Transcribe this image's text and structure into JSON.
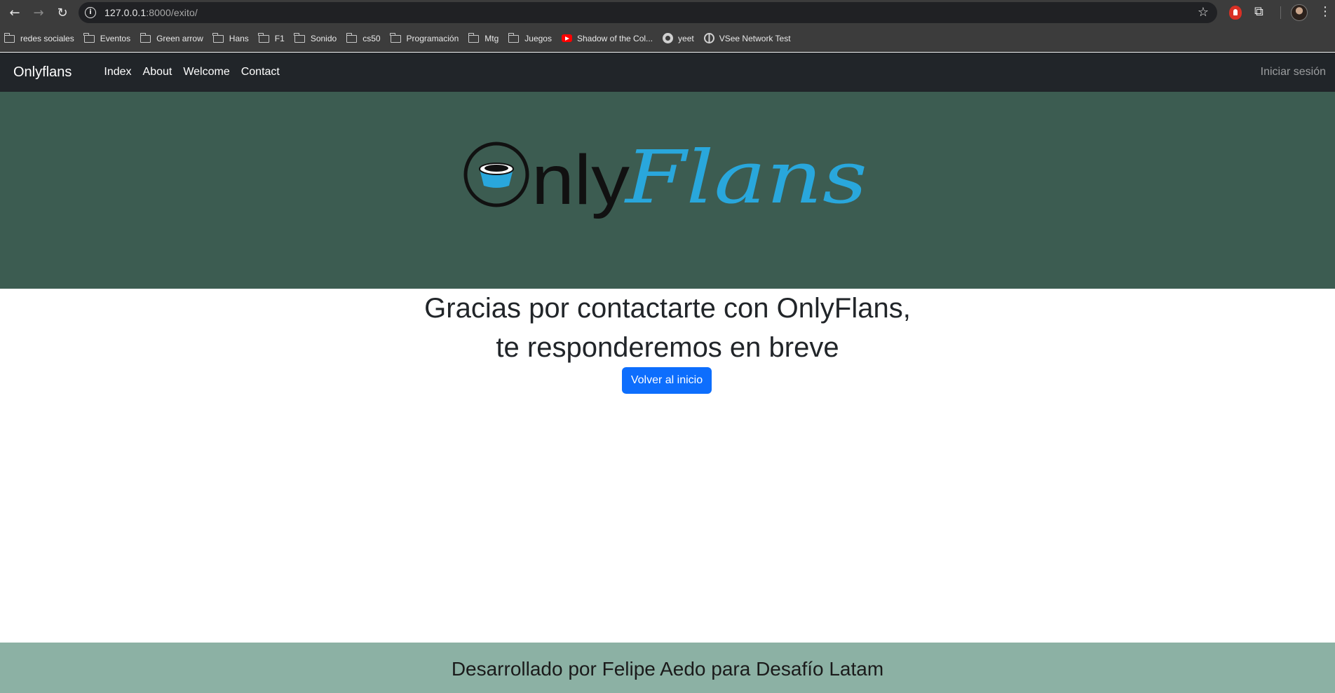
{
  "browser": {
    "url_host": "127.0.0.1",
    "url_path": ":8000/exito/",
    "bookmarks": [
      {
        "label": "redes sociales",
        "icon": "folder-icon"
      },
      {
        "label": "Eventos",
        "icon": "folder-icon"
      },
      {
        "label": "Green arrow",
        "icon": "folder-icon"
      },
      {
        "label": "Hans",
        "icon": "folder-icon"
      },
      {
        "label": "F1",
        "icon": "folder-icon"
      },
      {
        "label": "Sonido",
        "icon": "folder-icon"
      },
      {
        "label": "cs50",
        "icon": "folder-icon"
      },
      {
        "label": "Programación",
        "icon": "folder-icon"
      },
      {
        "label": "Mtg",
        "icon": "folder-icon"
      },
      {
        "label": "Juegos",
        "icon": "folder-icon"
      },
      {
        "label": "Shadow of the Col...",
        "icon": "youtube-icon"
      },
      {
        "label": "yeet",
        "icon": "github-icon"
      },
      {
        "label": "VSee Network Test",
        "icon": "globe-icon"
      }
    ]
  },
  "navbar": {
    "brand": "Onlyflans",
    "links": [
      "Index",
      "About",
      "Welcome",
      "Contact"
    ],
    "login": "Iniciar sesión"
  },
  "hero": {
    "logo_text_plain": "nly",
    "logo_text_script": "Flans",
    "colors": {
      "background": "#3c5c51",
      "logo_blue": "#29a7dc",
      "logo_dark": "#111111"
    }
  },
  "main": {
    "line1": "Gracias por contactarte con OnlyFlans,",
    "line2": "te responderemos en breve",
    "button": "Volver al inicio",
    "button_color": "#0d6efd"
  },
  "footer": {
    "text": "Desarrollado por Felipe Aedo para Desafío Latam",
    "color": "#8cb1a4"
  }
}
